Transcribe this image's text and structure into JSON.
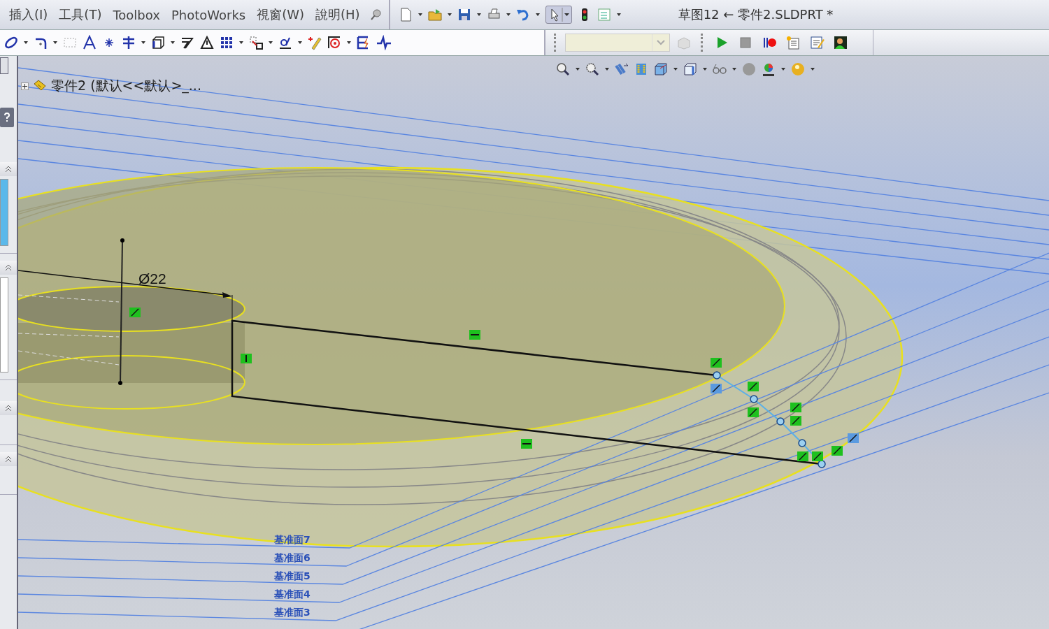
{
  "menu": [
    "插入(I)",
    "工具(T)",
    "Toolbox",
    "PhotoWorks",
    "視窗(W)",
    "說明(H)"
  ],
  "title": "草图12 ← 零件2.SLDPRT *",
  "feature_tree": {
    "root": {
      "label": "零件2 (默认<<默认>_...",
      "expanded": false
    }
  },
  "sketch": {
    "dimension": "Ø22"
  },
  "planes": [
    {
      "label": "基准面7"
    },
    {
      "label": "基准面6"
    },
    {
      "label": "基准面5"
    },
    {
      "label": "基准面4"
    },
    {
      "label": "基准面3"
    }
  ]
}
